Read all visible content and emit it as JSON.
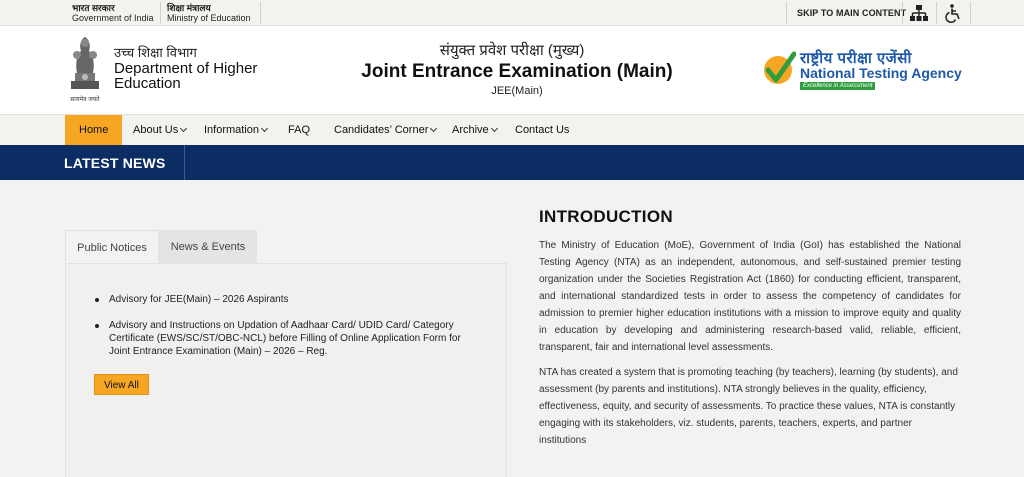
{
  "topbar": {
    "gov_hi": "भारत सरकार",
    "gov_en": "Government of India",
    "ministry_hi": "शिक्षा मंत्रालय",
    "ministry_en": "Ministry of Education",
    "skip_label": "SKIP TO MAIN CONTENT",
    "icons": [
      "sitemap-icon",
      "accessibility-icon"
    ]
  },
  "header": {
    "emblem_motto": "सत्यमेव जयते",
    "dept_hi": "उच्च शिक्षा विभाग",
    "dept_en": "Department of Higher Education",
    "exam_hi": "संयुक्त प्रवेश परीक्षा (मुख्य)",
    "exam_en": "Joint Entrance Examination (Main)",
    "exam_sub": "JEE(Main)",
    "nta_hi": "राष्ट्रीय परीक्षा एजेंसी",
    "nta_en": "National Testing Agency",
    "nta_tagline": "Excellence in Assessment"
  },
  "nav": {
    "items": [
      {
        "label": "Home",
        "active": true
      },
      {
        "label": "About Us",
        "dropdown": true
      },
      {
        "label": "Information",
        "dropdown": true
      },
      {
        "label": "FAQ"
      },
      {
        "label": "Candidates’ Corner",
        "dropdown": true
      },
      {
        "label": "Archive",
        "dropdown": true
      },
      {
        "label": "Contact Us"
      }
    ]
  },
  "news": {
    "title": "LATEST NEWS",
    "tabs": [
      "Public Notices",
      "News & Events"
    ],
    "items": [
      "Advisory for JEE(Main) – 2026 Aspirants",
      "Advisory and Instructions on Updation of Aadhaar Card/ UDID Card/ Category Certificate (EWS/SC/ST/OBC-NCL) before Filling of Online Application Form for Joint Entrance Examination (Main) – 2026 – Reg."
    ],
    "view_all": "View All"
  },
  "intro": {
    "title": "INTRODUCTION",
    "p1": "The Ministry of Education (MoE), Government of India (GoI) has established the National Testing Agency (NTA) as an independent, autonomous, and self-sustained premier testing organization under the Societies Registration Act (1860) for conducting efficient, transparent, and international standardized tests in order to assess the competency of candidates for admission to premier higher education institutions with a mission to improve equity and quality in education by developing and administering research-based valid, reliable, efficient, transparent, fair and international level assessments.",
    "p2": "NTA has created a system that is promoting teaching (by teachers), learning (by students), and assessment (by parents and institutions). NTA strongly believes in the quality, efficiency, effectiveness, equity, and security of assessments. To practice these values, NTA is constantly engaging with its stakeholders, viz. students, parents, teachers, experts, and partner institutions"
  },
  "colors": {
    "accent": "#f6a623",
    "navy": "#0c2d63",
    "nta_blue": "#1e5aa8"
  }
}
